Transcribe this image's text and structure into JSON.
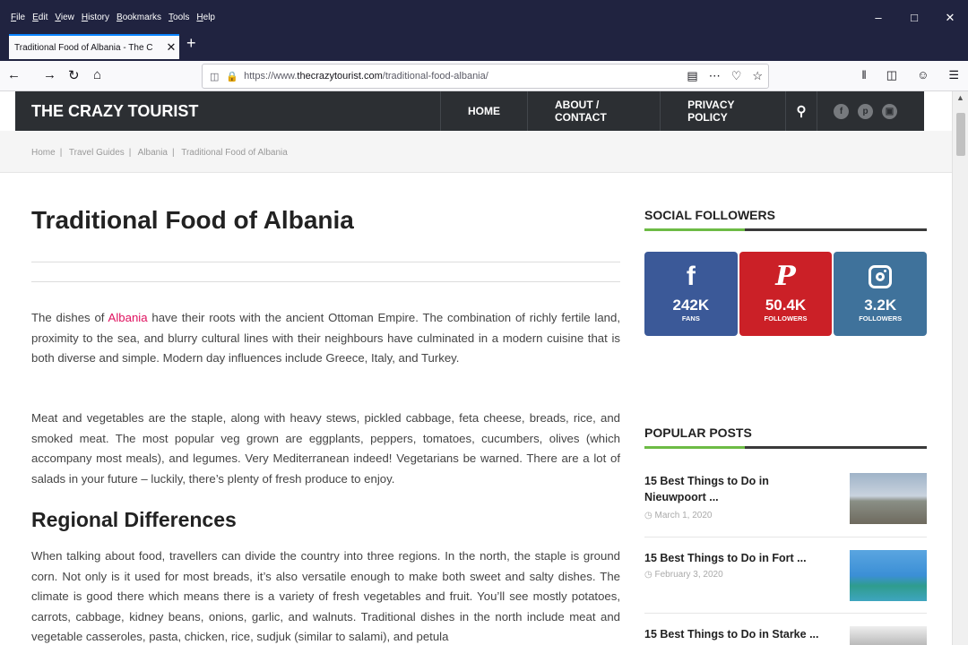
{
  "browser": {
    "menu": [
      "File",
      "Edit",
      "View",
      "History",
      "Bookmarks",
      "Tools",
      "Help"
    ],
    "tab_title": "Traditional Food of Albania - The C",
    "url_prefix": "https://www.",
    "url_domain": "thecrazytourist.com",
    "url_path": "/traditional-food-albania/"
  },
  "site": {
    "title": "THE CRAZY TOURIST",
    "nav": [
      "HOME",
      "ABOUT / CONTACT",
      "PRIVACY POLICY"
    ],
    "social_icons": [
      "facebook-icon",
      "pinterest-icon",
      "instagram-icon"
    ]
  },
  "breadcrumb": [
    "Home",
    "Travel Guides",
    "Albania",
    "Traditional Food of Albania"
  ],
  "article": {
    "title": "Traditional Food of Albania",
    "p1_before": "The dishes of ",
    "p1_link": "Albania",
    "p1_after": " have their roots with the ancient Ottoman Empire. The combination of richly fertile land, proximity to the sea, and blurry cultural lines with their neighbours have culminated in a modern cuisine that is both diverse and simple. Modern day influences include Greece, Italy, and Turkey.",
    "p2": "Meat and vegetables are the staple, along with heavy stews, pickled cabbage, feta cheese, breads, rice, and smoked meat. The most popular veg grown are eggplants, peppers, tomatoes, cucumbers, olives (which accompany most meals), and legumes.  Very Mediterranean indeed!  Vegetarians be warned.  There are a lot of salads in your future – luckily, there’s plenty of fresh produce to enjoy.",
    "h2": "Regional Differences",
    "p3": "When talking about food, travellers can divide the country into three regions.  In the north, the staple is ground corn. Not only is it used for most breads, it’s also versatile enough to make both sweet and salty dishes.  The climate is good there which means there is a variety of fresh vegetables and fruit. You’ll see mostly potatoes, carrots, cabbage, kidney beans, onions, garlic, and walnuts. Traditional dishes in the north include meat and vegetable casseroles, pasta, chicken, rice, sudjuk (similar to salami), and petula"
  },
  "sidebar": {
    "social_title": "SOCIAL FOLLOWERS",
    "social": [
      {
        "icon": "f",
        "count": "242K",
        "label": "FANS"
      },
      {
        "icon": "P",
        "count": "50.4K",
        "label": "FOLLOWERS"
      },
      {
        "icon": "",
        "count": "3.2K",
        "label": "FOLLOWERS"
      }
    ],
    "popular_title": "POPULAR POSTS",
    "posts": [
      {
        "title": "15 Best Things to Do in Nieuwpoort ...",
        "date": "March 1, 2020"
      },
      {
        "title": "15 Best Things to Do in Fort ...",
        "date": "February 3, 2020"
      },
      {
        "title": "15 Best Things to Do in Starke ...",
        "date": ""
      }
    ]
  },
  "colors": {
    "header_bg": "#2c2f33",
    "accent_green": "#6dbb45",
    "link_pink": "#e0115f",
    "facebook": "#3b5998",
    "pinterest": "#cb2027",
    "instagram": "#3f729b"
  }
}
